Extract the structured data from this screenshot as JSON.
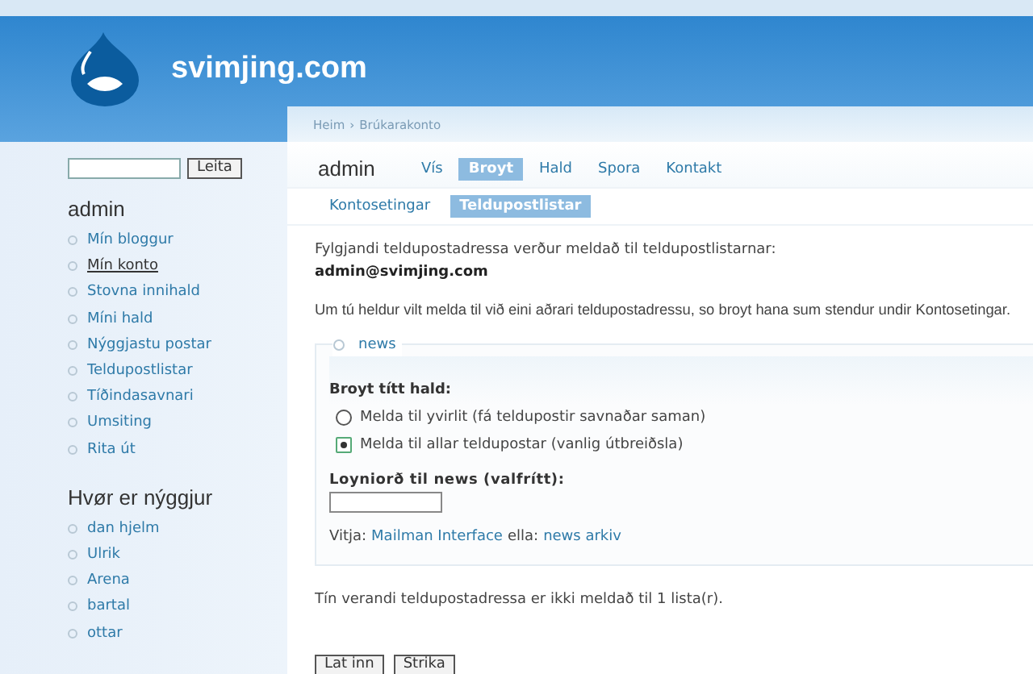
{
  "site": {
    "name": "svimjing.com"
  },
  "search": {
    "button": "Leita"
  },
  "user_menu": {
    "title": "admin",
    "items": [
      {
        "label": "Mín bloggur",
        "selected": false
      },
      {
        "label": "Mín konto",
        "selected": true
      },
      {
        "label": "Stovna innihald",
        "selected": false
      },
      {
        "label": "Míni hald",
        "selected": false
      },
      {
        "label": "Nýggjastu postar",
        "selected": false
      },
      {
        "label": "Teldupostlistar",
        "selected": false
      },
      {
        "label": "Tíðindasavnari",
        "selected": false
      },
      {
        "label": "Umsiting",
        "selected": false
      },
      {
        "label": "Rita út",
        "selected": false
      }
    ]
  },
  "new_users": {
    "title": "Hvør er nýggjur",
    "items": [
      "dan hjelm",
      "Ulrik",
      "Arena",
      "bartal",
      "ottar"
    ]
  },
  "breadcrumb": [
    "Heim",
    "Brúkarakonto"
  ],
  "breadcrumb_separator": "›",
  "page_title": "admin",
  "tabs": [
    {
      "label": "Vís",
      "selected": false
    },
    {
      "label": "Broyt",
      "selected": true
    },
    {
      "label": "Hald",
      "selected": false
    },
    {
      "label": "Spora",
      "selected": false
    },
    {
      "label": "Kontakt",
      "selected": false
    }
  ],
  "subtabs": [
    {
      "label": "Kontosetingar",
      "selected": false
    },
    {
      "label": "Teldupostlistar",
      "selected": true
    }
  ],
  "intro": "Fylgjandi teldupostadressa verður meldað til teldupostlistarnar:",
  "email": "admin@svimjing.com",
  "note": "Um tú heldur vilt melda til við eini aðrari teldupostadressu, so broyt hana sum stendur undir Kontosetingar.",
  "list": {
    "legend": "news",
    "prompt": "Broyt títt hald:",
    "options": [
      {
        "label": "Melda til yvirlit (fá teldupostir savnaðar saman)",
        "selected": false
      },
      {
        "label": "Melda til allar teldupostar (vanlig útbreiðsla)",
        "selected": true
      }
    ],
    "password_label": "Loyniorð til news (valfrítt):",
    "visit_label": "Vitja:",
    "visit_link": "Mailman Interface",
    "or_label": "ella:",
    "archive_link": "news arkiv"
  },
  "status": "Tín verandi teldupostadressa er ikki meldað til 1 lista(r).",
  "buttons": [
    "Lat inn",
    "Strika"
  ]
}
